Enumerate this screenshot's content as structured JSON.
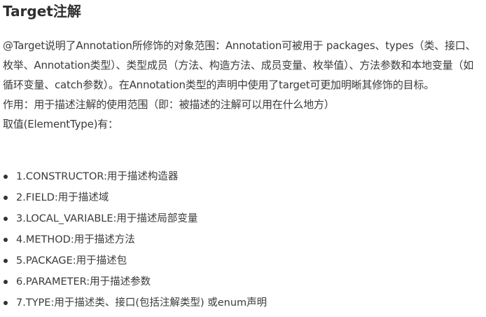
{
  "title": "Target注解",
  "paragraphs": [
    "@Target说明了Annotation所修饰的对象范围：Annotation可被用于 packages、types（类、接口、枚举、Annotation类型）、类型成员（方法、构造方法、成员变量、枚举值）、方法参数和本地变量（如循环变量、catch参数）。在Annotation类型的声明中使用了target可更加明晰其修饰的目标。",
    "作用：用于描述注解的使用范围（即：被描述的注解可以用在什么地方）",
    "取值(ElementType)有："
  ],
  "items": [
    "1.CONSTRUCTOR:用于描述构造器",
    "2.FIELD:用于描述域",
    "3.LOCAL_VARIABLE:用于描述局部变量",
    "4.METHOD:用于描述方法",
    "5.PACKAGE:用于描述包",
    "6.PARAMETER:用于描述参数",
    "7.TYPE:用于描述类、接口(包括注解类型) 或enum声明"
  ]
}
